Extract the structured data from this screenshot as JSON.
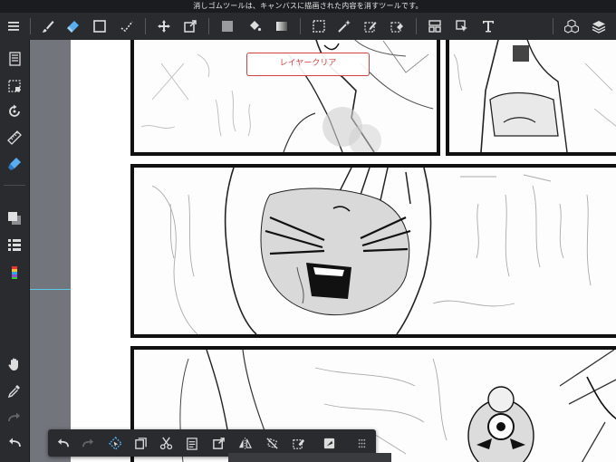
{
  "tip_text": "消しゴムツールは、キャンバスに描画された内容を消すツールです。",
  "popup_label": "レイヤークリア",
  "bottom_hint": "",
  "colors": {
    "accent": "#d04141",
    "toolbar_bg": "#2a2b2f",
    "active_tool": "#58aef0",
    "guide_line": "#58c9e8"
  },
  "top_tools": [
    "menu-icon",
    "brush-icon",
    "eraser-icon",
    "rectangle-icon",
    "line-icon",
    "move-icon",
    "transform-icon",
    "fill-color-icon",
    "bucket-icon",
    "gradient-icon",
    "selection-rect-icon",
    "magic-wand-icon",
    "selection-pen-icon",
    "selection-eraser-icon",
    "panel-tool-icon",
    "pointer-tool-icon",
    "text-icon",
    "materials-icon",
    "layers-icon"
  ],
  "side_tools": [
    "page-manager-icon",
    "select-all-icon",
    "rotate-icon",
    "ruler-icon",
    "highlighter-icon",
    "color-squares-icon",
    "layer-list-icon",
    "color-palette-icon",
    "hand-icon",
    "eyedropper-icon",
    "redo-icon",
    "undo-icon"
  ],
  "bottom_tools": [
    "undo-icon",
    "redo-icon",
    "select-transform-icon",
    "duplicate-icon",
    "cut-icon",
    "paste-icon",
    "transform-icon",
    "flip-icon",
    "rotate-off-icon",
    "edit-icon",
    "fill-icon",
    "more-icon"
  ]
}
